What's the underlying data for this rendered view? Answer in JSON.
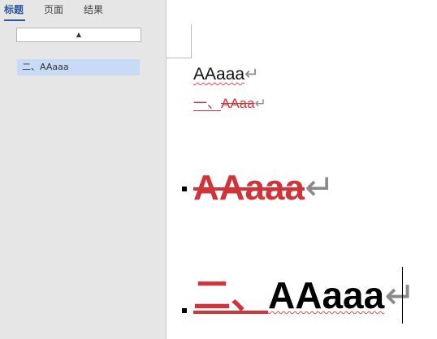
{
  "nav_pane": {
    "tabs": [
      {
        "label": "标题",
        "active": true
      },
      {
        "label": "页面",
        "active": false
      },
      {
        "label": "结果",
        "active": false
      }
    ],
    "collapse_glyph": "▲",
    "heading_items": [
      {
        "label": "二、AAaaa",
        "selected": true
      }
    ]
  },
  "document": {
    "line1": {
      "text": "AAaaa",
      "mark": "↵"
    },
    "line2": {
      "prefix": "一、",
      "text": "AAaa",
      "mark": "↵"
    },
    "line3": {
      "text": "AAaaa",
      "mark": "↵"
    },
    "line4": {
      "prefix": "二、",
      "text": "AAaaa",
      "mark": "↵"
    }
  },
  "colors": {
    "accent": "#2b579a",
    "revision": "#d13438",
    "selection": "#c7daf6"
  }
}
